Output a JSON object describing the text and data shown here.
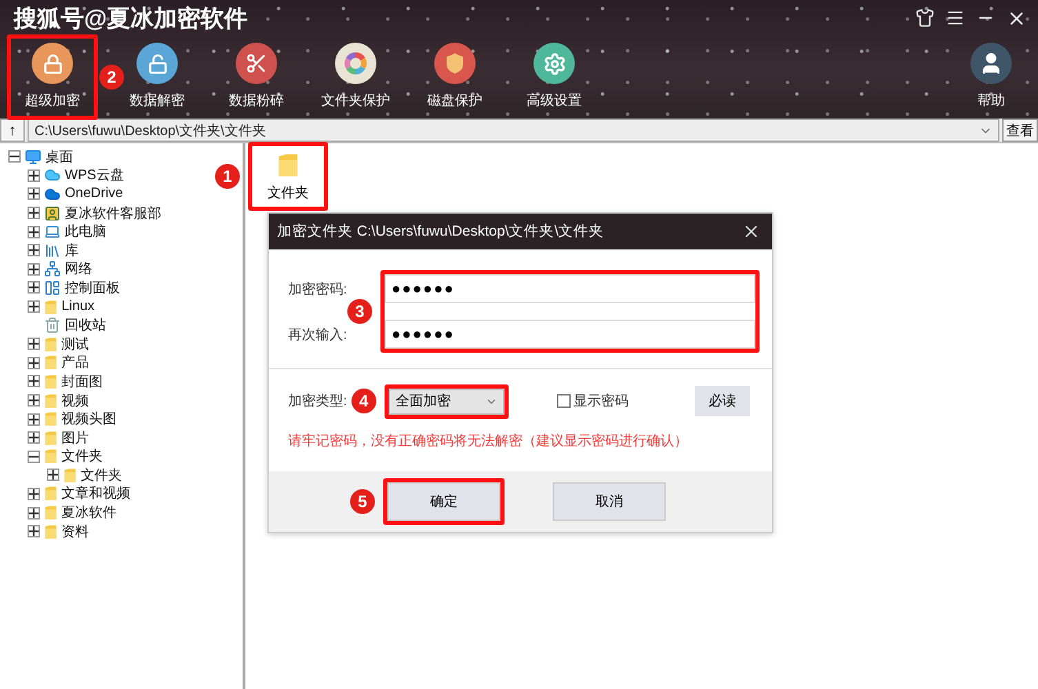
{
  "window": {
    "title": "搜狐号@夏冰加密软件",
    "controls": [
      {
        "kind": "skin"
      },
      {
        "kind": "menu"
      },
      {
        "kind": "minimize"
      },
      {
        "kind": "close"
      }
    ]
  },
  "toolbar": [
    {
      "label": "超级加密",
      "kind": "lock",
      "color": "#e8965a",
      "highlighted": true,
      "badge": "2"
    },
    {
      "label": "数据解密",
      "kind": "unlock",
      "color": "#5aa6d6",
      "highlighted": false
    },
    {
      "label": "数据粉碎",
      "kind": "shred",
      "color": "#d0524f",
      "highlighted": false
    },
    {
      "label": "文件夹保护",
      "kind": "ring",
      "color": "#e9e3d3",
      "highlighted": false
    },
    {
      "label": "磁盘保护",
      "kind": "shield",
      "color": "#d9564c",
      "highlighted": false
    },
    {
      "label": "高级设置",
      "kind": "gear",
      "color": "#4fb89a",
      "highlighted": false
    }
  ],
  "help": {
    "label": "帮助",
    "color": "#3f5568"
  },
  "address_bar": {
    "up_button": "↑",
    "path": "C:\\Users\\fuwu\\Desktop\\文件夹\\文件夹",
    "view_button": "查看"
  },
  "tree": [
    {
      "label": "桌面",
      "kind": "desktop",
      "expandable": true,
      "expanded": true,
      "children": [
        {
          "label": "WPS云盘",
          "kind": "cloud",
          "expandable": true,
          "expanded": false
        },
        {
          "label": "OneDrive",
          "kind": "onedrive",
          "expandable": true,
          "expanded": false
        },
        {
          "label": "夏冰软件客服部",
          "kind": "user",
          "expandable": true,
          "expanded": false
        },
        {
          "label": "此电脑",
          "kind": "pc",
          "expandable": true,
          "expanded": false
        },
        {
          "label": "库",
          "kind": "library",
          "expandable": true,
          "expanded": false
        },
        {
          "label": "网络",
          "kind": "network",
          "expandable": true,
          "expanded": false
        },
        {
          "label": "控制面板",
          "kind": "control",
          "expandable": true,
          "expanded": false
        },
        {
          "label": "Linux",
          "kind": "folder",
          "expandable": true,
          "expanded": false
        },
        {
          "label": "回收站",
          "kind": "recycle",
          "expandable": false,
          "expanded": false
        },
        {
          "label": "测试",
          "kind": "folder",
          "expandable": true,
          "expanded": false
        },
        {
          "label": "产品",
          "kind": "folder",
          "expandable": true,
          "expanded": false
        },
        {
          "label": "封面图",
          "kind": "folder",
          "expandable": true,
          "expanded": false
        },
        {
          "label": "视频",
          "kind": "folder",
          "expandable": true,
          "expanded": false
        },
        {
          "label": "视频头图",
          "kind": "folder",
          "expandable": true,
          "expanded": false
        },
        {
          "label": "图片",
          "kind": "folder",
          "expandable": true,
          "expanded": false
        },
        {
          "label": "文件夹",
          "kind": "folder",
          "expandable": true,
          "expanded": true,
          "children": [
            {
              "label": "文件夹",
              "kind": "folder",
              "expandable": true,
              "expanded": false
            }
          ]
        },
        {
          "label": "文章和视频",
          "kind": "folder",
          "expandable": true,
          "expanded": false
        },
        {
          "label": "夏冰软件",
          "kind": "folder",
          "expandable": true,
          "expanded": false
        },
        {
          "label": "资料",
          "kind": "folder",
          "expandable": true,
          "expanded": false
        }
      ]
    }
  ],
  "files": [
    {
      "label": "文件夹",
      "highlighted": true,
      "badge": "1"
    }
  ],
  "dialog": {
    "title": "加密文件夹 C:\\Users\\fuwu\\Desktop\\文件夹\\文件夹",
    "passwords": {
      "highlighted": true,
      "badge": "3",
      "fields": [
        {
          "label": "加密密码:",
          "value": "●●●●●●"
        },
        {
          "label": "再次输入:",
          "value": "●●●●●●"
        }
      ]
    },
    "type": {
      "label": "加密类型:",
      "value": "全面加密",
      "highlighted": true,
      "badge": "4"
    },
    "show_password": {
      "label": "显示密码",
      "checked": false
    },
    "read_button": "必读",
    "warning": "请牢记密码，没有正确密码将无法解密（建议显示密码进行确认）",
    "buttons": [
      {
        "label": "确定",
        "highlighted": true,
        "badge": "5"
      },
      {
        "label": "取消",
        "highlighted": false
      }
    ]
  }
}
